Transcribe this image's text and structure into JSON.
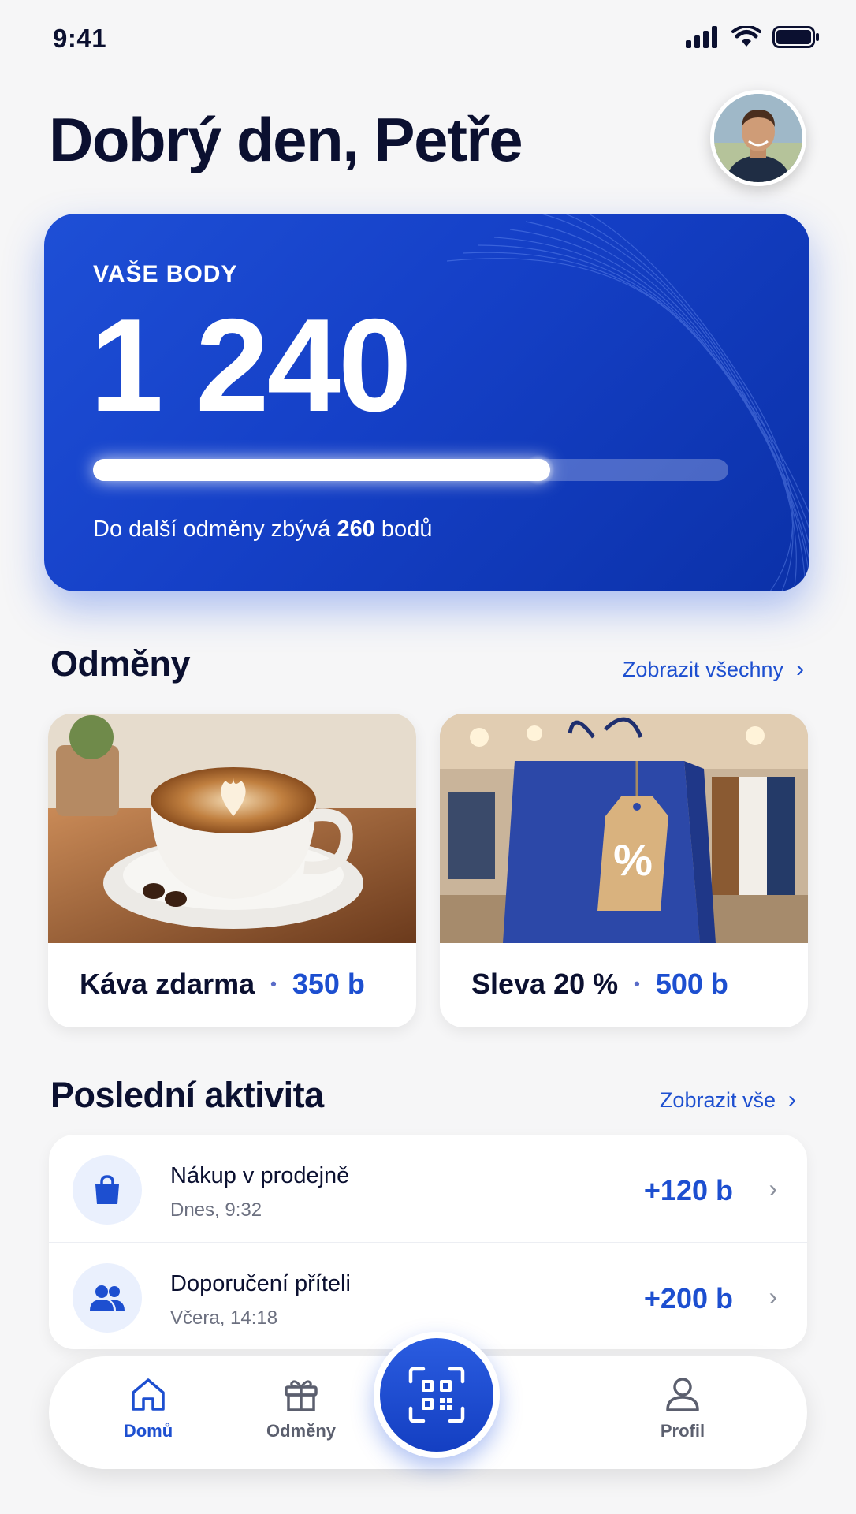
{
  "status_bar": {
    "time": "9:41"
  },
  "header": {
    "greeting": "Dobrý den, Petře"
  },
  "points_card": {
    "label": "VAŠE BODY",
    "value": "1 240",
    "progress_fraction": 0.72,
    "next_reward_prefix": "Do další odměny zbývá ",
    "next_reward_points": "260",
    "next_reward_suffix": " bodů"
  },
  "rewards": {
    "title": "Odměny",
    "link": "Zobrazit všechny",
    "items": [
      {
        "name": "Káva zdarma",
        "cost": "350 b"
      },
      {
        "name": "Sleva 20 %",
        "cost": "500 b"
      }
    ]
  },
  "activity": {
    "title": "Poslední aktivita",
    "link": "Zobrazit vše",
    "items": [
      {
        "title": "Nákup v prodejně",
        "time": "Dnes, 9:32",
        "points": "+120 b",
        "icon": "shopping-bag-icon"
      },
      {
        "title": "Doporučení příteli",
        "time": "Včera, 14:18",
        "points": "+200 b",
        "icon": "users-icon"
      }
    ]
  },
  "bottom_nav": {
    "items": [
      {
        "label": "Domů",
        "icon": "home-icon",
        "active": true
      },
      {
        "label": "Odměny",
        "icon": "gift-icon",
        "active": false
      },
      {
        "label": "Profil",
        "icon": "user-icon",
        "active": false
      }
    ],
    "scan_icon": "qr-scan-icon"
  },
  "colors": {
    "accent": "#1d4fd0",
    "card_gradient_start": "#1e4fd6",
    "card_gradient_end": "#0b31a8"
  }
}
